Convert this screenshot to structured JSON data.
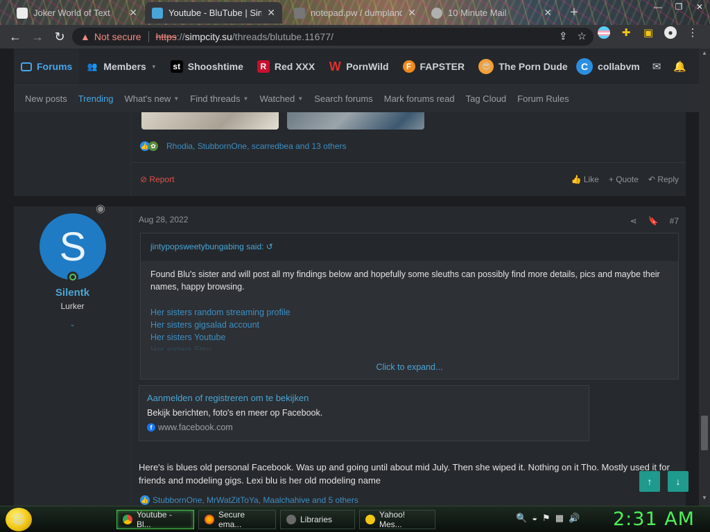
{
  "browser": {
    "tabs": [
      {
        "title": "Joker World of Text",
        "active": false
      },
      {
        "title": "Youtube - BluTube | Simp",
        "active": true
      },
      {
        "title": "notepad.pw / dumpland",
        "active": false
      },
      {
        "title": "10 Minute Mail",
        "active": false
      }
    ],
    "new_tab": "+",
    "not_secure": "Not secure",
    "url_scheme": "https",
    "url_sep": "://",
    "url_host": "simpcity.su",
    "url_path": "/threads/blutube.11677/"
  },
  "forum": {
    "nav": [
      {
        "label": "Forums"
      },
      {
        "label": "Members"
      },
      {
        "label": "Shooshtime",
        "icon_text": "st"
      },
      {
        "label": "Red XXX",
        "icon_text": "R"
      },
      {
        "label": "PornWild",
        "icon_text": "W"
      },
      {
        "label": "FAPSTER",
        "icon_text": "F"
      },
      {
        "label": "The Porn Dude"
      }
    ],
    "user": {
      "avatar_letter": "C",
      "name": "collabvm"
    },
    "subnav": [
      "New posts",
      "Trending",
      "What's new",
      "Find threads",
      "Watched",
      "Search forums",
      "Mark forums read",
      "Tag Cloud",
      "Forum Rules"
    ]
  },
  "post1": {
    "reactions_text": "Rhodia, StubbornOne, scarredbea and 13 others",
    "report": "Report",
    "like": "Like",
    "quote": "Quote",
    "reply": "Reply"
  },
  "post2": {
    "avatar_letter": "S",
    "username": "Silentk",
    "user_title": "Lurker",
    "date": "Aug 28, 2022",
    "post_number": "#7",
    "quote_author": "jintypopsweetybungabing said:",
    "quote_text": "Found Blu's sister and will post all my findings below and hopefully some sleuths can possibly find more details, pics and maybe their names, happy browsing.",
    "quote_links": [
      "Her sisters random streaming profile",
      "Her sisters gigsalad account",
      "Her sisters Youtube",
      "Her sisters Etsy"
    ],
    "expand": "Click to expand...",
    "embed_title": "Aanmelden of registreren om te bekijken",
    "embed_desc": "Bekijk berichten, foto's en meer op Facebook.",
    "embed_src": "www.facebook.com",
    "body": "Here's is blues old personal Facebook. Was up and going until about mid July. Then she wiped it. Nothing on it Tho. Mostly used it for friends and modeling gigs. Lexi blu is her old modeling name",
    "reactions_text": "StubbornOne, MrWatZitToYa, Maalchahive and 5 others"
  },
  "taskbar": {
    "tasks": [
      "Youtube - Bl...",
      "Secure ema...",
      "Libraries",
      "Yahoo! Mes..."
    ],
    "clock": "2:31 AM"
  }
}
